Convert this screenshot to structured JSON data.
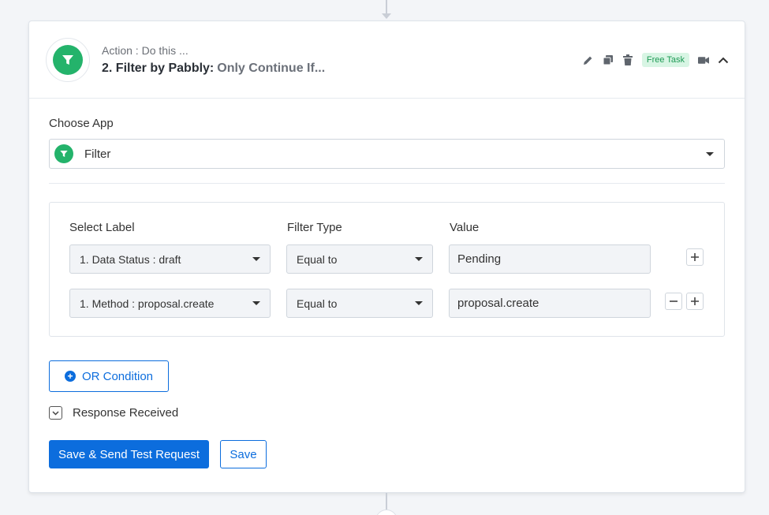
{
  "step": {
    "subtitle": "Action : Do this ...",
    "title_main": "2. Filter by Pabbly:",
    "title_suffix": "Only Continue If...",
    "badge": "Free Task"
  },
  "icons": {
    "logo": "filter-funnel-icon",
    "edit": "pencil-icon",
    "copy": "copy-icon",
    "delete": "trash-icon",
    "video": "video-camera-icon",
    "collapse": "chevron-up-icon"
  },
  "choose_app": {
    "label": "Choose App",
    "value": "Filter"
  },
  "filter": {
    "headers": {
      "label": "Select Label",
      "type": "Filter Type",
      "value": "Value"
    },
    "rows": [
      {
        "label": "1. Data Status : draft",
        "type": "Equal to",
        "value": "Pending"
      },
      {
        "label": "1. Method : proposal.create",
        "type": "Equal to",
        "value": "proposal.create"
      }
    ]
  },
  "or_condition": "OR Condition",
  "response": "Response Received",
  "buttons": {
    "save_send": "Save & Send Test Request",
    "save": "Save"
  },
  "colors": {
    "brand_green": "#24b36b",
    "primary_blue": "#0c6ddd",
    "badge_bg": "#d8f5e4",
    "badge_text": "#1e9a55"
  }
}
